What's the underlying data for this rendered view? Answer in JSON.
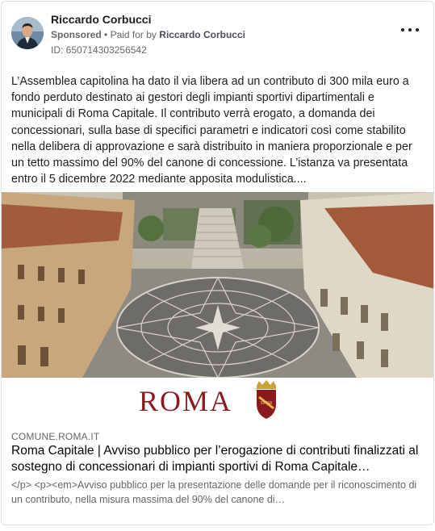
{
  "post": {
    "author_name": "Riccardo Corbucci",
    "sponsored_label": "Sponsored",
    "separator": "•",
    "paid_prefix": "Paid for by",
    "payer_name": "Riccardo Corbucci",
    "ad_id": "ID: 650714303256542",
    "more_icon": "more-horizontal-icon",
    "text": "L’Assemblea capitolina ha dato il via libera ad un contributo di 300 mila euro a fondo perduto destinato ai gestori degli impianti sportivi dipartimentali e municipali di Roma Capitale. Il contributo verrà erogato, a domanda dei concessionari, sulla base di specifici parametri e indicatori così come stabilito nella delibera di approvazione e sarà distribuito in maniera proporzionale e per un tetto massimo del 90% del canone di concessione. L’istanza va presentata entro il 5 dicembre 2022 mediante apposita modulistica...."
  },
  "media": {
    "logo_text": "ROMA",
    "logo_color": "#8b1a1e",
    "crest_text": "SPQR"
  },
  "link_preview": {
    "domain": "COMUNE.ROMA.IT",
    "title": "Roma Capitale | Avviso pubblico per l’erogazione di contributi finalizzati al sostegno di concessionari di impianti sportivi di Roma Capitale…",
    "description": "</p> <p><em>Avviso pubblico per la presentazione delle domande per il riconoscimento di un contributo, nella misura massima del 90% del canone di…"
  }
}
